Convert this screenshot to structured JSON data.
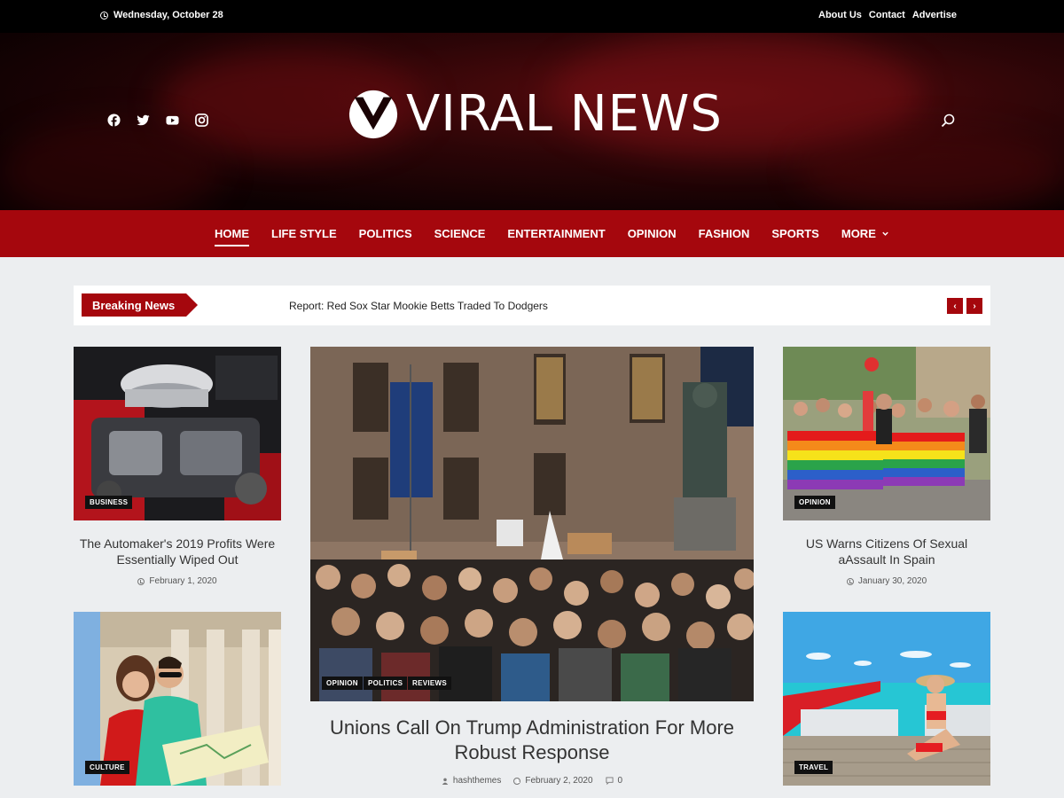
{
  "topbar": {
    "date": "Wednesday, October 28",
    "links": [
      "About Us",
      "Contact",
      "Advertise"
    ]
  },
  "header": {
    "logo_text": "VIRAL NEWS",
    "social_icons": [
      "facebook-icon",
      "twitter-icon",
      "youtube-icon",
      "instagram-icon"
    ]
  },
  "nav": {
    "items": [
      "HOME",
      "LIFE STYLE",
      "POLITICS",
      "SCIENCE",
      "ENTERTAINMENT",
      "OPINION",
      "FASHION",
      "SPORTS",
      "MORE"
    ],
    "active": "HOME"
  },
  "breaking": {
    "label": "Breaking News",
    "headline": "Report: Red Sox Star Mookie Betts Traded To Dodgers",
    "prev": "‹",
    "next": "›"
  },
  "cards": {
    "left_top": {
      "category": "BUSINESS",
      "title": "The Automaker's 2019 Profits Were Essentially Wiped Out",
      "date": "February 1, 2020"
    },
    "left_bottom": {
      "category": "CULTURE"
    },
    "right_top": {
      "category": "OPINION",
      "title": "US Warns Citizens Of Sexual aAssault In Spain",
      "date": "January 30, 2020"
    },
    "right_bottom": {
      "category": "TRAVEL"
    }
  },
  "featured": {
    "categories": [
      "OPINION",
      "POLITICS",
      "REVIEWS"
    ],
    "title": "Unions Call On Trump Administration For More Robust Response",
    "author": "hashthemes",
    "date": "February 2, 2020",
    "comments": "0"
  },
  "colors": {
    "brand_red": "#a5070d",
    "topbar_bg": "#000000",
    "page_bg": "#eceef0"
  }
}
